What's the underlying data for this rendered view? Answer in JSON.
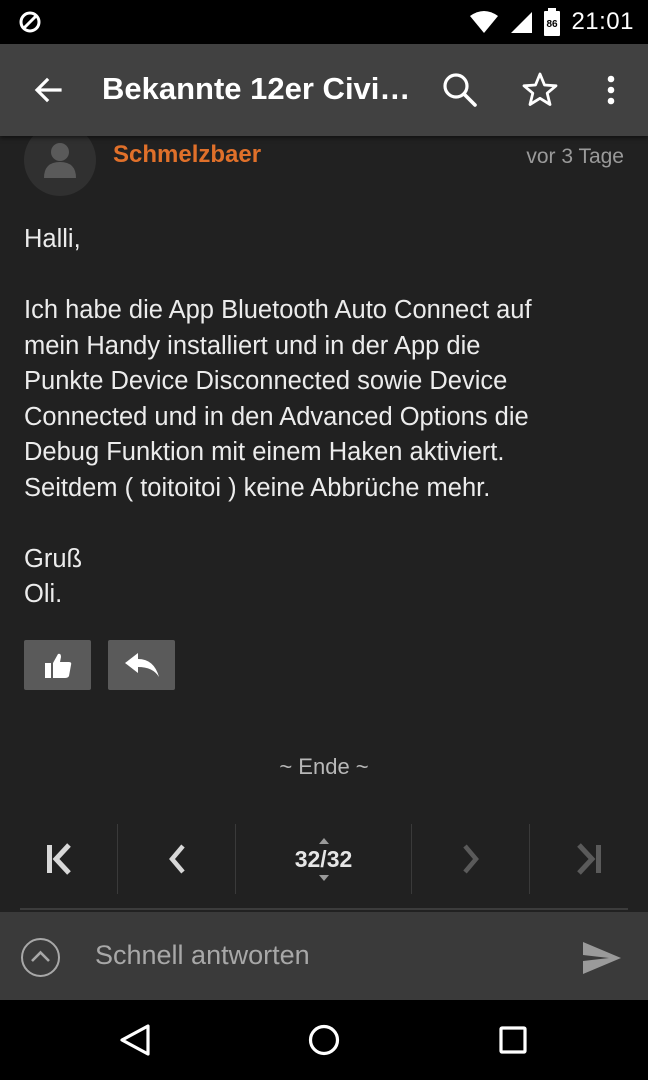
{
  "status_bar": {
    "time": "21:01",
    "battery_level": "86"
  },
  "app_bar": {
    "title": "Bekannte 12er Civi…",
    "icons": [
      "back-arrow-icon",
      "search-icon",
      "star-icon",
      "overflow-menu-icon"
    ]
  },
  "post": {
    "author": "Schmelzbaer",
    "date": "vor 3 Tage",
    "greeting": "Halli,",
    "lines": [
      "Ich habe die App Bluetooth Auto Connect auf",
      "mein Handy installiert und in der App die",
      "Punkte Device Disconnected sowie Device",
      "Connected und in den Advanced Options die",
      "Debug Funktion mit einem Haken aktiviert.",
      "Seitdem ( toitoitoi ) keine Abbrüche mehr."
    ],
    "signoff_1": "Gruß",
    "signoff_2": "Oli.",
    "icons": [
      "like-icon",
      "reply-icon"
    ]
  },
  "end_label": "~ Ende ~",
  "pager": {
    "page_label": "32/32"
  },
  "reply_bar": {
    "placeholder": "Schnell antworten"
  },
  "colors": {
    "accent": "#e0702a",
    "app_bar": "#414141",
    "background": "#212121"
  }
}
